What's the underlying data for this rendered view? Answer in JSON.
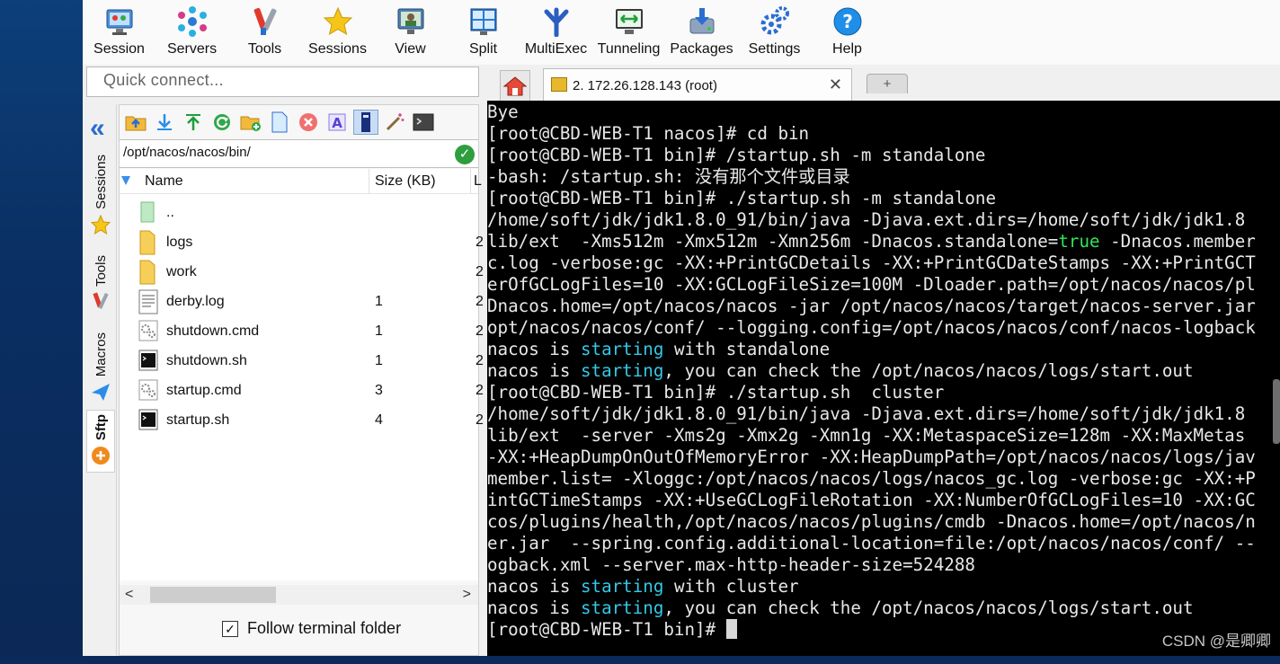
{
  "toolbar": {
    "items": [
      {
        "label": "Session",
        "icon": "session-icon"
      },
      {
        "label": "Servers",
        "icon": "servers-icon"
      },
      {
        "label": "Tools",
        "icon": "tools-icon"
      },
      {
        "label": "Sessions",
        "icon": "star-icon"
      },
      {
        "label": "View",
        "icon": "view-icon"
      },
      {
        "label": "Split",
        "icon": "split-icon"
      },
      {
        "label": "MultiExec",
        "icon": "multiexec-icon"
      },
      {
        "label": "Tunneling",
        "icon": "tunneling-icon"
      },
      {
        "label": "Packages",
        "icon": "packages-icon"
      },
      {
        "label": "Settings",
        "icon": "settings-icon"
      },
      {
        "label": "Help",
        "icon": "help-icon"
      }
    ]
  },
  "quick_connect": {
    "placeholder": "Quick connect..."
  },
  "side_tabs": [
    {
      "label": "Sessions",
      "icon": "star-icon"
    },
    {
      "label": "Tools",
      "icon": "tools-icon"
    },
    {
      "label": "Macros",
      "icon": "paper-plane-icon"
    },
    {
      "label": "Sftp",
      "icon": "sftp-icon",
      "active": true
    }
  ],
  "sftp": {
    "path": "/opt/nacos/nacos/bin/",
    "columns": {
      "name": "Name",
      "size": "Size (KB)",
      "last": "L"
    },
    "files": [
      {
        "name": "..",
        "size": "",
        "type": "up",
        "last": ""
      },
      {
        "name": "logs",
        "size": "",
        "type": "folder",
        "last": "2"
      },
      {
        "name": "work",
        "size": "",
        "type": "folder",
        "last": "2"
      },
      {
        "name": "derby.log",
        "size": "1",
        "type": "text",
        "last": "2"
      },
      {
        "name": "shutdown.cmd",
        "size": "1",
        "type": "cmd",
        "last": "2"
      },
      {
        "name": "shutdown.sh",
        "size": "1",
        "type": "sh",
        "last": "2"
      },
      {
        "name": "startup.cmd",
        "size": "3",
        "type": "cmd",
        "last": "2"
      },
      {
        "name": "startup.sh",
        "size": "4",
        "type": "sh",
        "last": "2"
      }
    ],
    "follow_label": "Follow terminal folder",
    "follow_checked": true
  },
  "terminal_tab": {
    "title": "2. 172.26.128.143 (root)"
  },
  "terminal": {
    "lines": [
      [
        {
          "t": "Bye"
        }
      ],
      [
        {
          "t": "[root@CBD-WEB-T1 nacos]# cd bin"
        }
      ],
      [
        {
          "t": "[root@CBD-WEB-T1 bin]# /startup.sh -m standalone"
        }
      ],
      [
        {
          "t": "-bash: /startup.sh: 没有那个文件或目录"
        }
      ],
      [
        {
          "t": "[root@CBD-WEB-T1 bin]# ./startup.sh -m standalone"
        }
      ],
      [
        {
          "t": "/home/soft/jdk/jdk1.8.0_91/bin/java -Djava.ext.dirs=/home/soft/jdk/jdk1.8"
        }
      ],
      [
        {
          "t": "lib/ext  -Xms512m -Xmx512m -Xmn256m -Dnacos.standalone="
        },
        {
          "t": "true",
          "c": "g"
        },
        {
          "t": " -Dnacos.member"
        }
      ],
      [
        {
          "t": "c.log -verbose:gc -XX:+PrintGCDetails -XX:+PrintGCDateStamps -XX:+PrintGCT"
        }
      ],
      [
        {
          "t": "erOfGCLogFiles=10 -XX:GCLogFileSize=100M -Dloader.path=/opt/nacos/nacos/pl"
        }
      ],
      [
        {
          "t": "Dnacos.home=/opt/nacos/nacos -jar /opt/nacos/nacos/target/nacos-server.jar"
        }
      ],
      [
        {
          "t": "opt/nacos/nacos/conf/ --logging.config=/opt/nacos/nacos/conf/nacos-logback"
        }
      ],
      [
        {
          "t": "nacos is "
        },
        {
          "t": "starting",
          "c": "c"
        },
        {
          "t": " with standalone"
        }
      ],
      [
        {
          "t": "nacos is "
        },
        {
          "t": "starting",
          "c": "c"
        },
        {
          "t": ", you can check the /opt/nacos/nacos/logs/start.out"
        }
      ],
      [
        {
          "t": "[root@CBD-WEB-T1 bin]# ./startup.sh  cluster"
        }
      ],
      [
        {
          "t": "/home/soft/jdk/jdk1.8.0_91/bin/java -Djava.ext.dirs=/home/soft/jdk/jdk1.8"
        }
      ],
      [
        {
          "t": "lib/ext  -server -Xms2g -Xmx2g -Xmn1g -XX:MetaspaceSize=128m -XX:MaxMetas"
        }
      ],
      [
        {
          "t": "-XX:+HeapDumpOnOutOfMemoryError -XX:HeapDumpPath=/opt/nacos/nacos/logs/jav"
        }
      ],
      [
        {
          "t": "member.list= -Xloggc:/opt/nacos/nacos/logs/nacos_gc.log -verbose:gc -XX:+P"
        }
      ],
      [
        {
          "t": "intGCTimeStamps -XX:+UseGCLogFileRotation -XX:NumberOfGCLogFiles=10 -XX:GC"
        }
      ],
      [
        {
          "t": "cos/plugins/health,/opt/nacos/nacos/plugins/cmdb -Dnacos.home=/opt/nacos/n"
        }
      ],
      [
        {
          "t": "er.jar  --spring.config.additional-location=file:/opt/nacos/nacos/conf/ --"
        }
      ],
      [
        {
          "t": "ogback.xml --server.max-http-header-size=524288"
        }
      ],
      [
        {
          "t": "nacos is "
        },
        {
          "t": "starting",
          "c": "c"
        },
        {
          "t": " with cluster"
        }
      ],
      [
        {
          "t": "nacos is "
        },
        {
          "t": "starting",
          "c": "c"
        },
        {
          "t": ", you can check the /opt/nacos/nacos/logs/start.out"
        }
      ],
      [
        {
          "t": "[root@CBD-WEB-T1 bin]# "
        }
      ]
    ]
  },
  "watermark": "CSDN @是卿卿"
}
